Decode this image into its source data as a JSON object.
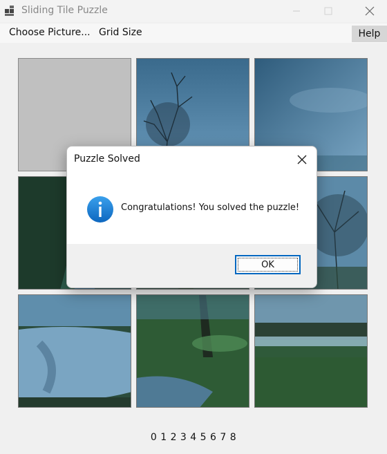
{
  "window": {
    "title": "Sliding Tile Puzzle"
  },
  "menu": {
    "choose_picture": "Choose Picture...",
    "grid_size": "Grid Size",
    "help": "Help"
  },
  "tiles": [
    {
      "index": 0,
      "blank": true
    },
    {
      "index": 1,
      "blank": false
    },
    {
      "index": 2,
      "blank": false
    },
    {
      "index": 3,
      "blank": false
    },
    {
      "index": 4,
      "blank": false
    },
    {
      "index": 5,
      "blank": false
    },
    {
      "index": 6,
      "blank": false
    },
    {
      "index": 7,
      "blank": false
    },
    {
      "index": 8,
      "blank": false
    }
  ],
  "tile_order_text": "0 1 2 3 4 5 6 7 8",
  "dialog": {
    "title": "Puzzle Solved",
    "message": "Congratulations! You solved the puzzle!",
    "ok_label": "OK",
    "icon": "info-icon"
  },
  "colors": {
    "accent": "#0067c0",
    "blank_tile": "#c0c0c0",
    "info_icon": "#1a7fd6"
  }
}
